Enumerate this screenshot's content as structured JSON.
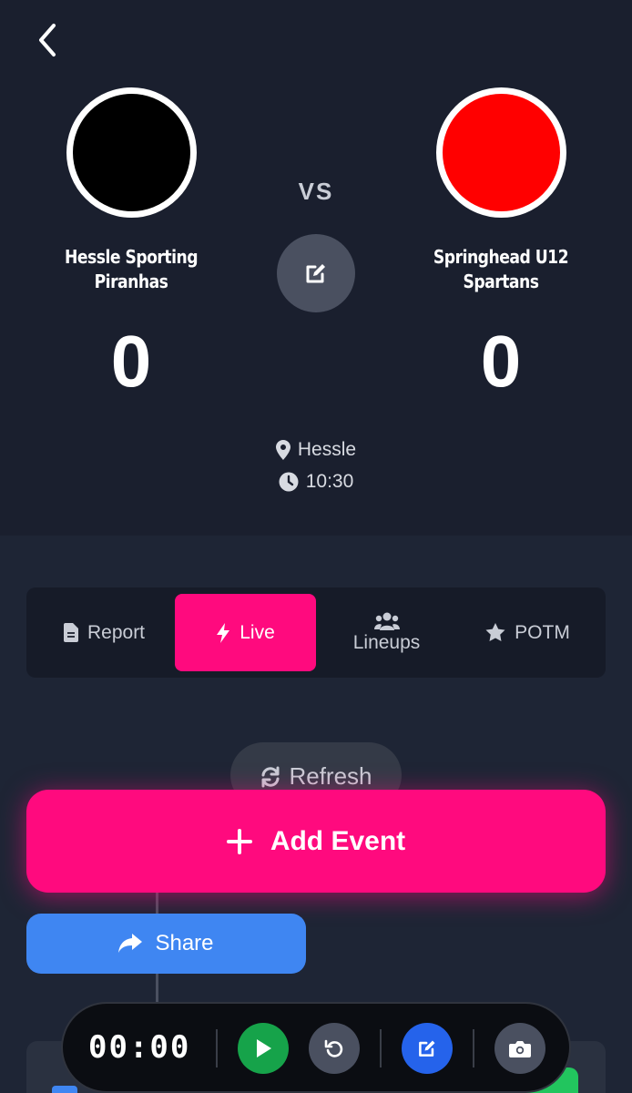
{
  "match": {
    "vs_label": "VS",
    "home": {
      "name_line1": "Hessle Sporting",
      "name_line2": "Piranhas",
      "score": "0",
      "color": "#000000"
    },
    "away": {
      "name_line1": "Springhead U12",
      "name_line2": "Spartans",
      "score": "0",
      "color": "#ff0000"
    },
    "venue": "Hessle",
    "time": "10:30"
  },
  "tabs": {
    "report": "Report",
    "live": "Live",
    "lineups": "Lineups",
    "potm": "POTM",
    "active": "live"
  },
  "actions": {
    "refresh": "Refresh",
    "add_event": "Add Event",
    "share": "Share"
  },
  "timer": {
    "display": "00:00"
  },
  "icons": {
    "back": "chevron-left-icon",
    "edit": "pen-to-square-icon",
    "venue": "map-pin-icon",
    "time": "clock-icon",
    "report": "file-icon",
    "live": "bolt-icon",
    "lineups": "users-icon",
    "potm": "star-icon",
    "refresh": "refresh-icon",
    "add": "plus-icon",
    "share": "share-icon",
    "play": "play-icon",
    "undo": "undo-icon",
    "camera": "camera-icon"
  },
  "colors": {
    "accent": "#ff0a7e",
    "share": "#3f86f2",
    "play": "#16a34a",
    "edit": "#2563eb",
    "header_bg": "#1a1f2e",
    "body_bg": "#1e2535"
  }
}
